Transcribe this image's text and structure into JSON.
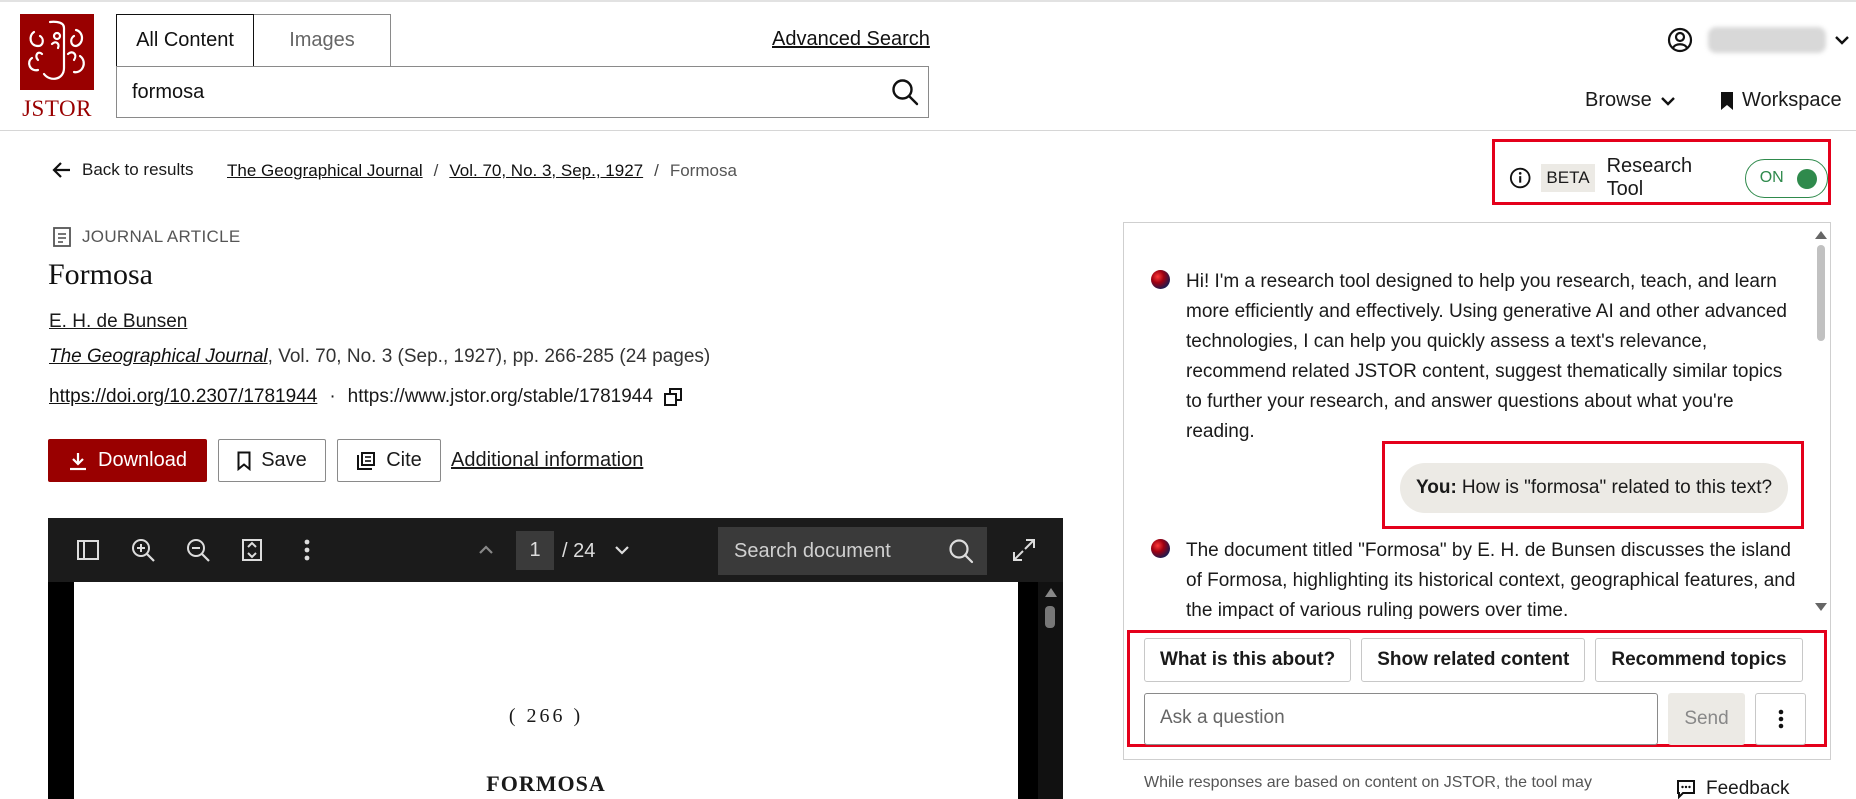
{
  "header": {
    "logo_text": "JSTOR",
    "tabs": [
      {
        "label": "All Content",
        "active": true
      },
      {
        "label": "Images",
        "active": false
      }
    ],
    "advanced_search": "Advanced Search",
    "search_value": "formosa",
    "browse": "Browse",
    "workspace": "Workspace",
    "user_icon": "user-circle-icon"
  },
  "breadcrumb": {
    "back": "Back to results",
    "items": [
      "The Geographical Journal",
      "Vol. 70, No. 3, Sep., 1927"
    ],
    "current": "Formosa",
    "separator": "/"
  },
  "research_tool": {
    "badge": "BETA",
    "title": "Research Tool",
    "toggle": "ON",
    "accent": "#2f8a4c"
  },
  "article": {
    "type": "JOURNAL ARTICLE",
    "title": "Formosa",
    "author": "E. H. de Bunsen",
    "journal": "The Geographical Journal",
    "citation_rest": ", Vol. 70, No. 3 (Sep., 1927), pp. 266-285 (24 pages)",
    "doi": "https://doi.org/10.2307/1781944",
    "separator": "·",
    "stable_url": "https://www.jstor.org/stable/1781944"
  },
  "actions": {
    "download": "Download",
    "save": "Save",
    "cite": "Cite",
    "additional": "Additional information",
    "brand_color": "#990000"
  },
  "viewer": {
    "page": "1",
    "page_total": "/ 24",
    "search_placeholder": "Search document",
    "page_number_text": "( 266 )",
    "page_heading": "FORMOSA"
  },
  "chat": {
    "intro": "Hi! I'm a research tool designed to help you research, teach, and learn more efficiently and effectively. Using generative AI and other advanced technologies, I can help you quickly assess a text's relevance, recommend related JSTOR content, suggest thematically similar topics to further your research, and answer questions about what you're reading.",
    "user_prefix": "You:",
    "user_question": "How is \"formosa\" related to this text?",
    "answer": "The document titled \"Formosa\" by E. H. de Bunsen discusses the island of Formosa, highlighting its historical context, geographical features, and the impact of various ruling powers over time.",
    "quick_actions": [
      "What is this about?",
      "Show related content",
      "Recommend topics"
    ],
    "ask_placeholder": "Ask a question",
    "send": "Send"
  },
  "footer": {
    "disclaimer": "While responses are based on content on JSTOR, the tool may",
    "feedback": "Feedback"
  },
  "highlight_color": "#e4001b"
}
